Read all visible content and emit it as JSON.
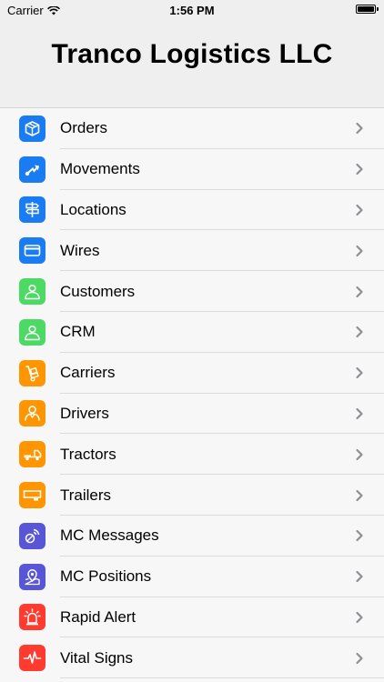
{
  "status_bar": {
    "carrier": "Carrier",
    "time": "1:56 PM"
  },
  "header": {
    "title": "Tranco Logistics LLC"
  },
  "colors": {
    "blue": "#1a7cf2",
    "green": "#4cd964",
    "orange": "#ff9500",
    "purple": "#5856d6",
    "red": "#ff3b30"
  },
  "menu": [
    {
      "label": "Orders",
      "icon": "package-icon",
      "color": "blue"
    },
    {
      "label": "Movements",
      "icon": "route-arrow-icon",
      "color": "blue"
    },
    {
      "label": "Locations",
      "icon": "signpost-icon",
      "color": "blue"
    },
    {
      "label": "Wires",
      "icon": "card-icon",
      "color": "blue"
    },
    {
      "label": "Customers",
      "icon": "person-icon",
      "color": "green"
    },
    {
      "label": "CRM",
      "icon": "person-icon",
      "color": "green"
    },
    {
      "label": "Carriers",
      "icon": "hand-truck-icon",
      "color": "orange"
    },
    {
      "label": "Drivers",
      "icon": "driver-icon",
      "color": "orange"
    },
    {
      "label": "Tractors",
      "icon": "truck-icon",
      "color": "orange"
    },
    {
      "label": "Trailers",
      "icon": "trailer-icon",
      "color": "orange"
    },
    {
      "label": "MC Messages",
      "icon": "satellite-icon",
      "color": "purple"
    },
    {
      "label": "MC Positions",
      "icon": "map-pin-icon",
      "color": "purple"
    },
    {
      "label": "Rapid Alert",
      "icon": "siren-icon",
      "color": "red"
    },
    {
      "label": "Vital Signs",
      "icon": "heartbeat-icon",
      "color": "red"
    }
  ]
}
